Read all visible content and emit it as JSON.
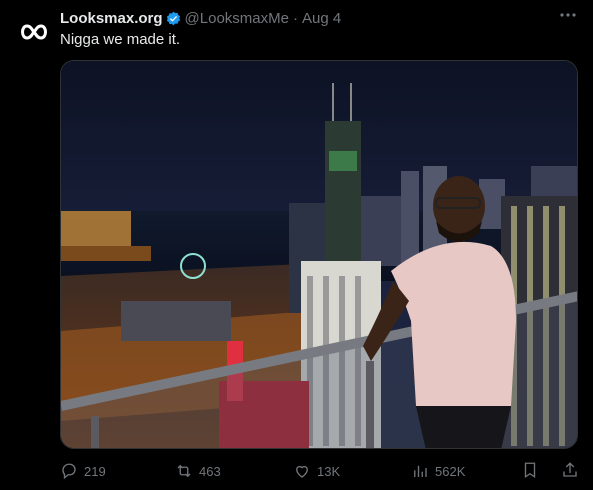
{
  "tweet": {
    "author_name": "Looksmax.org",
    "handle": "@LooksmaxMe",
    "separator": "·",
    "time": "Aug 4",
    "text": "Nigga we made it.",
    "avatar_icon": "looksmax-logo-icon",
    "verified_icon": "verified-badge-icon",
    "verified_color": "#1d9bf0"
  },
  "stats": {
    "replies": "219",
    "retweets": "463",
    "likes": "13K",
    "views": "562K"
  },
  "colors": {
    "background": "#000000",
    "text_primary": "#e7e9ea",
    "text_secondary": "#71767b"
  }
}
